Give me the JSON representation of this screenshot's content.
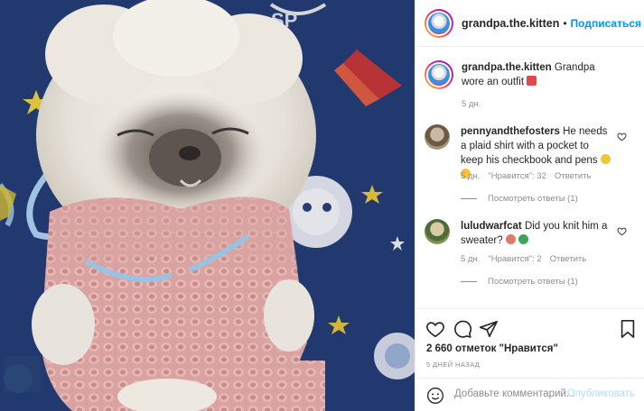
{
  "header": {
    "username": "grandpa.the.kitten",
    "separator": "•",
    "follow_label": "Подписаться"
  },
  "caption": {
    "username": "grandpa.the.kitten",
    "text": "Grandpa wore an outfit",
    "time": "5 дн."
  },
  "comments": [
    {
      "username": "pennyandthefosters",
      "text": "He needs a plaid shirt with a pocket to keep his checkbook and pens",
      "time": "5 дн.",
      "likes": "\"Нравится\": 32",
      "reply_label": "Ответить",
      "view_replies": "Посмотреть ответы (1)"
    },
    {
      "username": "luludwarfcat",
      "text": "Did you knit him a sweater?",
      "time": "5 дн.",
      "likes": "\"Нравится\": 2",
      "reply_label": "Ответить",
      "view_replies": "Посмотреть ответы (1)"
    }
  ],
  "actions": {
    "likes_count": "2 660 отметок \"Нравится\"",
    "posted_ago": "5 ДНЕЙ НАЗАД"
  },
  "add_comment": {
    "placeholder": "Добавьте комментарий...",
    "post_label": "Опубликовать"
  },
  "colors": {
    "accent": "#0095f6",
    "secondary_text": "#8e8e8e",
    "border": "#efefef",
    "sweater": "#d99a9a"
  }
}
